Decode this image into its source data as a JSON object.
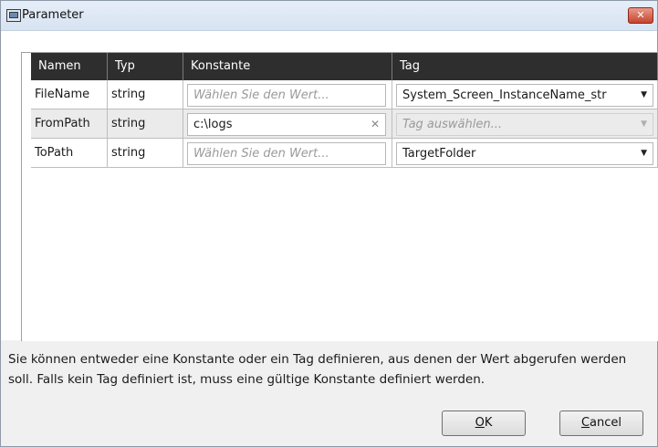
{
  "window": {
    "title": "Parameter",
    "close_glyph": "✕"
  },
  "table": {
    "headers": [
      "Namen",
      "Typ",
      "Konstante",
      "Tag"
    ],
    "rows": [
      {
        "name": "FileName",
        "type": "string",
        "constant_placeholder": "Wählen Sie den Wert...",
        "constant_value": "",
        "tag": "System_Screen_InstanceName_str",
        "tag_placeholder": "",
        "enabled": true
      },
      {
        "name": "FromPath",
        "type": "string",
        "constant_placeholder": "",
        "constant_value": "c:\\logs",
        "tag": "",
        "tag_placeholder": "Tag auswählen...",
        "enabled": false
      },
      {
        "name": "ToPath",
        "type": "string",
        "constant_placeholder": "Wählen Sie den Wert...",
        "constant_value": "",
        "tag": "TargetFolder",
        "tag_placeholder": "",
        "enabled": true
      }
    ]
  },
  "hint": "Sie können entweder eine Konstante oder ein Tag definieren, aus denen der Wert abgerufen werden soll. Falls kein Tag definiert ist, muss eine gültige Konstante definiert werden.",
  "buttons": {
    "ok_label": "OK",
    "ok_key": "O",
    "ok_rest": "K",
    "cancel_label": "Cancel",
    "cancel_key": "C",
    "cancel_rest": "ancel"
  },
  "icons": {
    "title": "window-icon",
    "clear": "clear-x-icon",
    "dropdown": "chevron-down-icon"
  },
  "colors": {
    "header_bg": "#2e2e2e",
    "close_red": "#c8432d",
    "placeholder": "#9a9a9a"
  }
}
